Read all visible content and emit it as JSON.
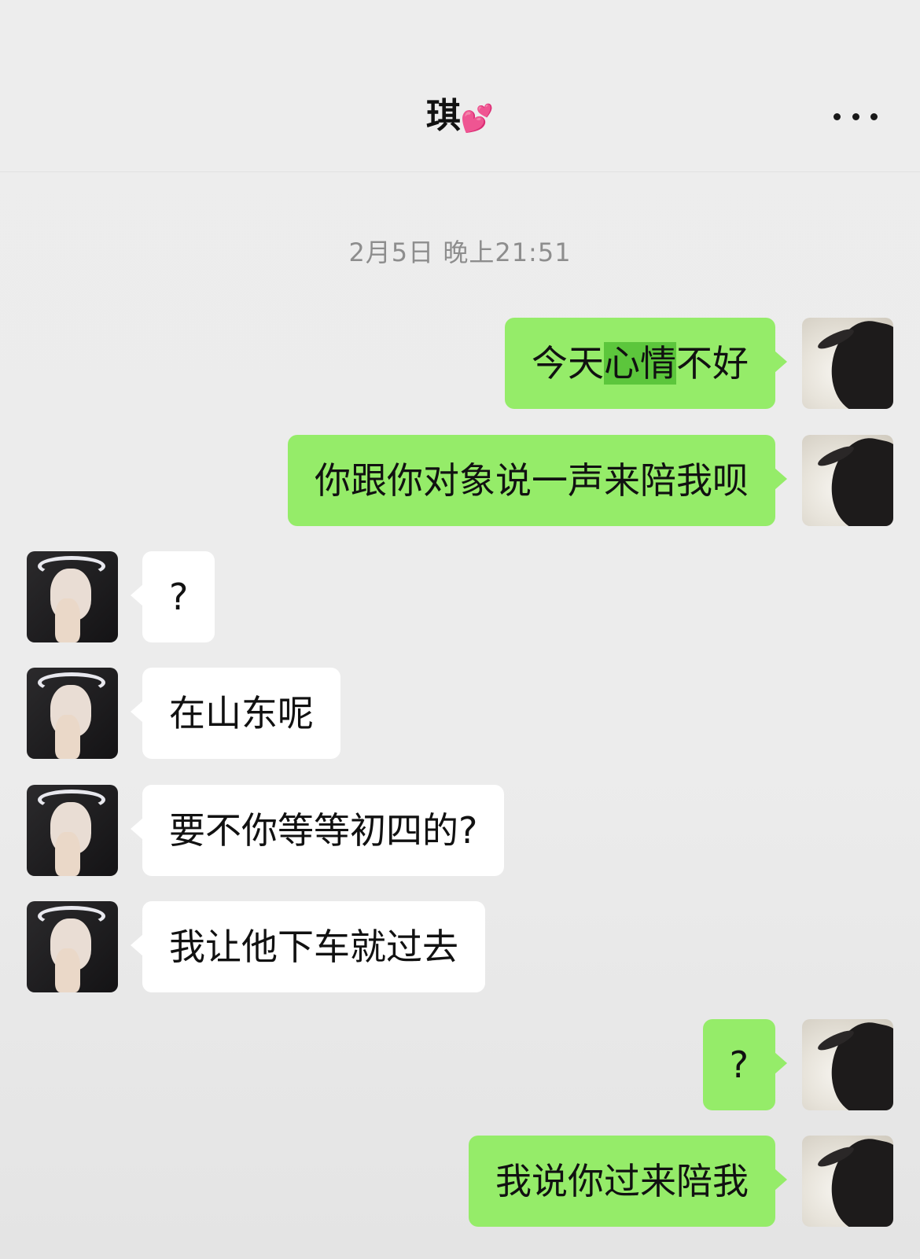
{
  "header": {
    "contact_name": "琪",
    "contact_emoji": "💕",
    "more_label": "..."
  },
  "chat": {
    "timestamp": "2月5日 晚上21:51",
    "messages": [
      {
        "side": "me",
        "text_parts": [
          "今天",
          "心情",
          "不好"
        ],
        "highlight_index": 1
      },
      {
        "side": "me",
        "text": "你跟你对象说一声来陪我呗"
      },
      {
        "side": "her",
        "text": "?"
      },
      {
        "side": "her",
        "text": "在山东呢"
      },
      {
        "side": "her",
        "text": "要不你等等初四的?"
      },
      {
        "side": "her",
        "text": "我让他下车就过去"
      },
      {
        "side": "me",
        "text": "?"
      },
      {
        "side": "me",
        "text": "我说你过来陪我"
      }
    ]
  },
  "colors": {
    "outgoing_bubble": "#95ec69",
    "incoming_bubble": "#ffffff",
    "highlight": "#5cc63c",
    "background": "#ededed"
  }
}
